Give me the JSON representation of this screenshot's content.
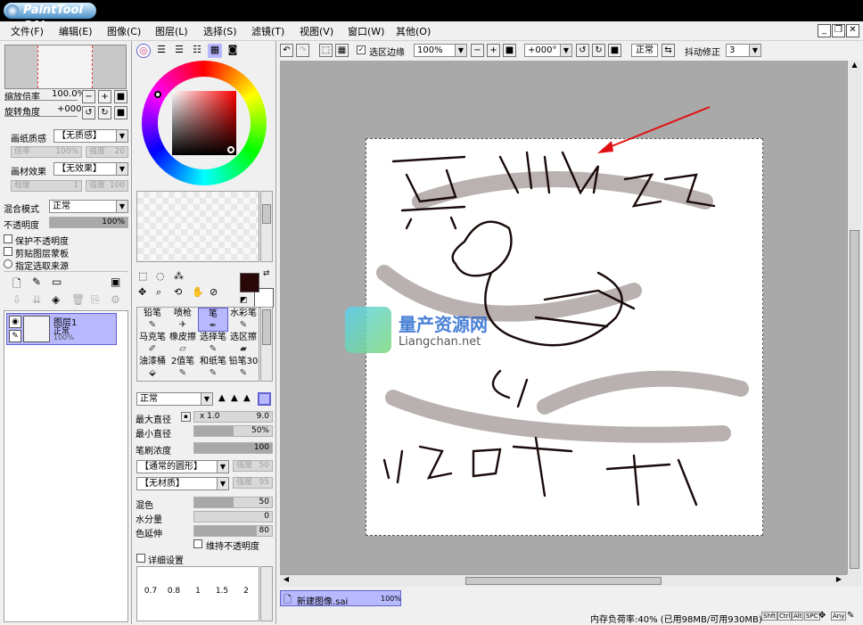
{
  "app": {
    "logo_text": "PaintTool SAI"
  },
  "window_controls": {
    "minimize": "_",
    "restore": "❐",
    "close": "✕"
  },
  "menu": [
    "文件(F)",
    "编辑(E)",
    "图像(C)",
    "图层(L)",
    "选择(S)",
    "滤镜(T)",
    "视图(V)",
    "窗口(W)",
    "其他(O)"
  ],
  "navigator": {
    "zoom_label": "缩放倍率",
    "zoom_value": "100.0%",
    "rotate_label": "旋转角度",
    "rotate_value": "+000"
  },
  "paper": {
    "texture_label": "画纸质感",
    "texture_value": "【无质感】",
    "scale_label": "倍率",
    "scale_value": "100%",
    "strength_label": "强度",
    "strength_value": "20",
    "effect_label": "画材效果",
    "effect_value": "【无效果】",
    "degree_label": "程度",
    "degree_value": "1",
    "strength2_label": "强度",
    "strength2_value": "100"
  },
  "layer_props": {
    "blend_label": "混合模式",
    "blend_value": "正常",
    "opacity_label": "不透明度",
    "opacity_value": "100%",
    "opacity_fraction": 1.0,
    "protect_opacity": "保护不透明度",
    "clip_mask": "剪贴图层蒙板",
    "selection_source": "指定选取来源"
  },
  "layer_list": [
    {
      "name": "图层1",
      "mode": "正常",
      "opacity": "100%"
    }
  ],
  "tools": [
    {
      "label": "铅笔",
      "icon": "pencil-icon",
      "glyph": "✎"
    },
    {
      "label": "喷枪",
      "icon": "airbrush-icon",
      "glyph": "✈"
    },
    {
      "label": "笔",
      "icon": "brush-icon",
      "glyph": "✒",
      "active": true
    },
    {
      "label": "水彩笔",
      "icon": "watercolor-icon",
      "glyph": "✎"
    },
    {
      "label": "马克笔",
      "icon": "marker-icon",
      "glyph": "✐"
    },
    {
      "label": "橡皮擦",
      "icon": "eraser-icon",
      "glyph": "▱"
    },
    {
      "label": "选择笔",
      "icon": "select-pen-icon",
      "glyph": "✎"
    },
    {
      "label": "选区擦",
      "icon": "select-eraser-icon",
      "glyph": "▰"
    },
    {
      "label": "油漆桶",
      "icon": "bucket-icon",
      "glyph": "⬙"
    },
    {
      "label": "2值笔",
      "icon": "binary-pen-icon",
      "glyph": "✎"
    },
    {
      "label": "和纸笔",
      "icon": "washi-pen-icon",
      "glyph": "✎"
    },
    {
      "label": "铅笔30",
      "icon": "pencil30-icon",
      "glyph": "✎"
    }
  ],
  "brush": {
    "mode_value": "正常",
    "max_size_label": "最大直径",
    "max_size_multiplier": "x 1.0",
    "max_size_value": "9.0",
    "min_size_label": "最小直径",
    "min_size_value": "50%",
    "min_size_fraction": 0.5,
    "density_label": "笔刷浓度",
    "density_value": "100",
    "density_fraction": 1.0,
    "shape_value": "【通常的圆形】",
    "shape_strength_label": "强度",
    "shape_strength_value": "50",
    "texture_value": "【无材质】",
    "texture_strength_label": "强度",
    "texture_strength_value": "95",
    "blend_label": "混色",
    "blend_value": "50",
    "blend_fraction": 0.5,
    "water_label": "水分量",
    "water_value": "0",
    "water_fraction": 0.0,
    "stretch_label": "色延伸",
    "stretch_value": "80",
    "stretch_fraction": 0.8,
    "keep_opacity": "维持不透明度",
    "detail": "详细设置"
  },
  "brush_sizes": [
    "0.7",
    "0.8",
    "1",
    "1.5",
    "2"
  ],
  "canvas_toolbar": {
    "selection_edge": "选区边缘",
    "zoom_value": "100%",
    "angle_value": "+000°",
    "mode_value": "正常",
    "stabilizer_label": "抖动修正",
    "stabilizer_value": "3"
  },
  "canvas_text": {
    "watermark_cn": "量产资源网",
    "watermark_en": "Liangchan.net"
  },
  "doc_tabs": [
    {
      "name": "新建图像.sai",
      "zoom": "100%"
    }
  ],
  "status": {
    "memory": "内存负荷率:40% (已用98MB/可用930MB)",
    "keys": [
      "Shft",
      "Ctrl",
      "Alt",
      "SPC",
      "Any"
    ]
  },
  "colors": {
    "accent": "#b8b8ff",
    "foreground": "#2a0808",
    "background": "#ffffff"
  }
}
